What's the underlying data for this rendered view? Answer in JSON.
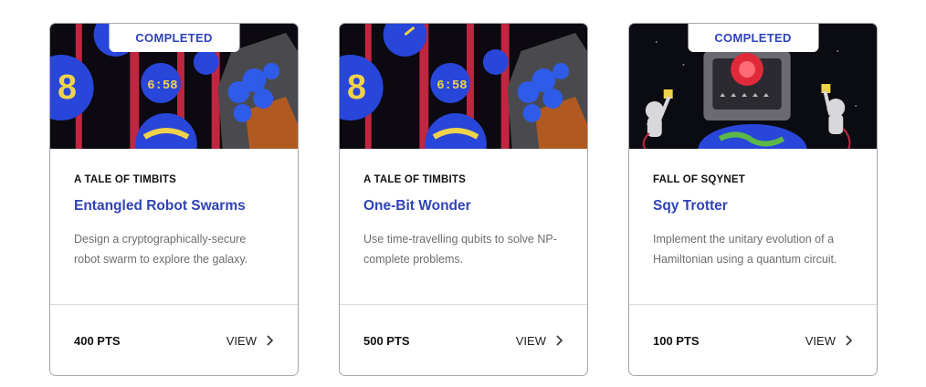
{
  "cards": [
    {
      "badge": "COMPLETED",
      "category": "A TALE OF TIMBITS",
      "title": "Entangled Robot Swarms",
      "description": "Design a cryptographically-secure robot swarm to explore the galaxy.",
      "points": "400 PTS",
      "view_label": "VIEW",
      "art_clock_text": "6:58",
      "art_orb_glyph": "8"
    },
    {
      "badge": "",
      "category": "A TALE OF TIMBITS",
      "title": "One-Bit Wonder",
      "description": "Use time-travelling qubits to solve NP-complete problems.",
      "points": "500 PTS",
      "view_label": "VIEW",
      "art_clock_text": "6:58",
      "art_orb_glyph": "8"
    },
    {
      "badge": "COMPLETED",
      "category": "FALL OF SQYNET",
      "title": "Sqy Trotter",
      "description": "Implement the unitary evolution of a Hamiltonian using a quantum circuit.",
      "points": "100 PTS",
      "view_label": "VIEW"
    }
  ],
  "colors": {
    "accent": "#2f43b8",
    "orb_blue": "#2846d9",
    "orb_yellow": "#f0d24a",
    "stripe_red": "#c0263f",
    "robot_red": "#e02a3a"
  },
  "icons": [
    "chevron-right-icon"
  ]
}
